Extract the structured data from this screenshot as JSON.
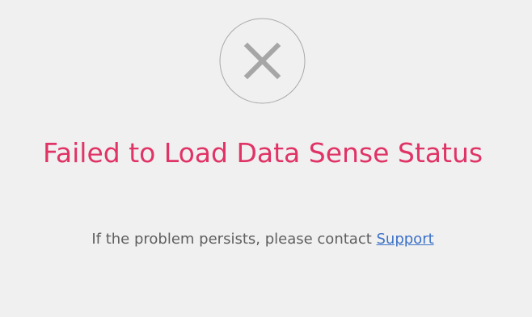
{
  "error": {
    "icon": "close-circle-icon",
    "title": "Failed to Load Data Sense Status",
    "message_prefix": "If the problem persists, please contact ",
    "support_link_label": "Support"
  },
  "colors": {
    "background": "#f0f0f0",
    "title": "#e03366",
    "text": "#5f5f5f",
    "link": "#3d72c7",
    "icon_circle": "#a9a9a9",
    "icon_cross": "#a6a6a6"
  }
}
